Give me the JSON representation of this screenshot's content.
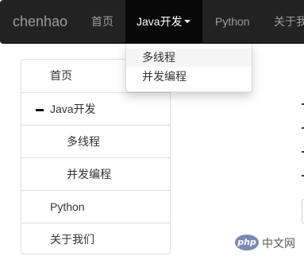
{
  "navbar": {
    "brand": "chenhao",
    "items": [
      {
        "label": "首页"
      },
      {
        "label": "Java开发"
      },
      {
        "label": "Python"
      },
      {
        "label": "关于我们"
      }
    ]
  },
  "dropdown": {
    "items": [
      {
        "label": "多线程"
      },
      {
        "label": "并发编程"
      }
    ]
  },
  "sidebar": {
    "items": [
      {
        "label": "首页"
      },
      {
        "label": "Java开发"
      },
      {
        "label": "多线程"
      },
      {
        "label": "并发编程"
      },
      {
        "label": "Python"
      },
      {
        "label": "关于我们"
      }
    ]
  },
  "watermark": {
    "logo": "php",
    "text": "中文网"
  }
}
